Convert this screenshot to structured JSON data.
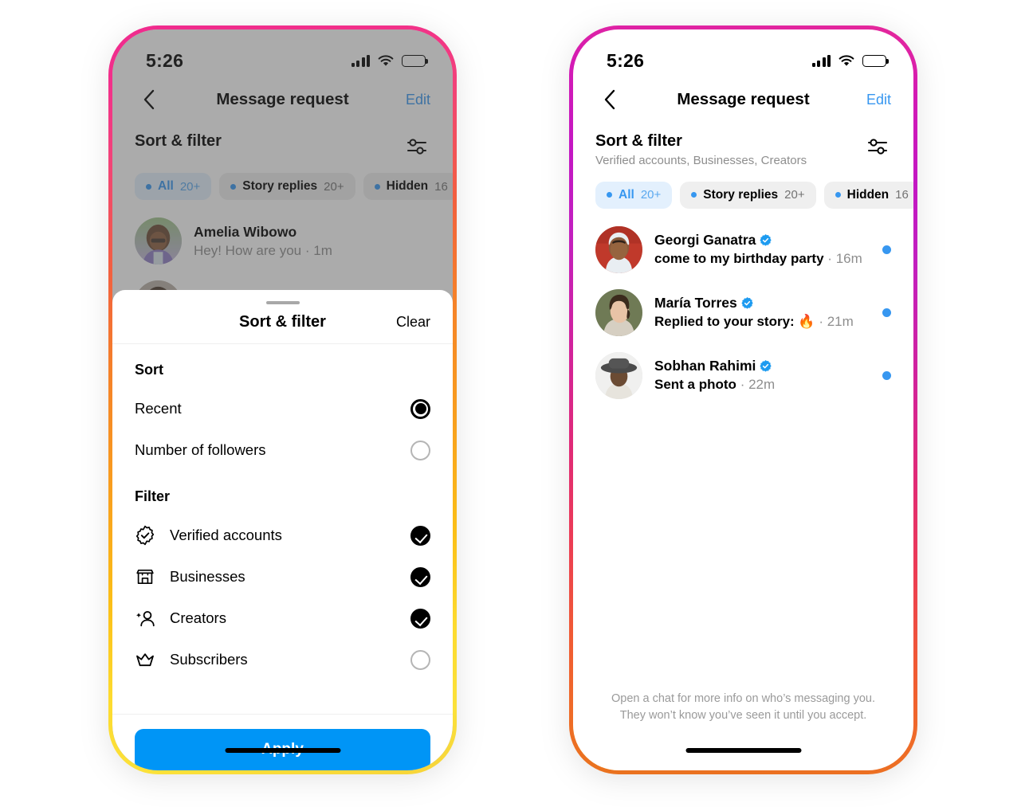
{
  "status_bar": {
    "time": "5:26",
    "signal_icon": "cellular-bars-icon",
    "wifi_icon": "wifi-icon",
    "battery_icon": "battery-full-icon"
  },
  "colors": {
    "accent_blue": "#3797f0",
    "button_blue": "#0095f6",
    "chip_active_bg": "#e3f0fd",
    "chip_bg": "#efefef",
    "muted_text": "#8e8e8e",
    "verified_blue": "#1d9bf0"
  },
  "nav": {
    "back_icon": "chevron-left-icon",
    "title": "Message request",
    "edit_label": "Edit"
  },
  "sort_filter_header": {
    "title": "Sort & filter",
    "subtitle_left": "",
    "subtitle_right": "Verified accounts, Businesses, Creators",
    "icon": "sliders-filter-icon"
  },
  "chips": [
    {
      "label": "All",
      "count": "20+",
      "active": true
    },
    {
      "label": "Story replies",
      "count": "20+",
      "active": false
    },
    {
      "label": "Hidden",
      "count": "16",
      "active": false
    }
  ],
  "left_phone": {
    "messages": [
      {
        "name": "Amelia Wibowo",
        "verified": false,
        "preview": "Hey! How are you",
        "time": "1m",
        "unread": false
      }
    ]
  },
  "right_phone": {
    "messages": [
      {
        "name": "Georgi Ganatra",
        "verified": true,
        "preview": "come to my birthday party",
        "time": "16m",
        "unread": true
      },
      {
        "name": "María Torres",
        "verified": true,
        "preview": "Replied to your story: 🔥",
        "time": "21m",
        "unread": true
      },
      {
        "name": "Sobhan Rahimi",
        "verified": true,
        "preview": "Sent a photo",
        "time": "22m",
        "unread": true
      }
    ],
    "footnote": "Open a chat for more info on who’s messaging you. They won’t know you’ve seen it until you accept."
  },
  "sheet": {
    "title": "Sort & filter",
    "clear_label": "Clear",
    "sort_label": "Sort",
    "sort_options": [
      {
        "label": "Recent",
        "selected": true
      },
      {
        "label": "Number of followers",
        "selected": false
      }
    ],
    "filter_label": "Filter",
    "filter_options": [
      {
        "label": "Verified accounts",
        "icon": "verified-badge-icon",
        "checked": true
      },
      {
        "label": "Businesses",
        "icon": "storefront-icon",
        "checked": true
      },
      {
        "label": "Creators",
        "icon": "creator-person-star-icon",
        "checked": true
      },
      {
        "label": "Subscribers",
        "icon": "crown-icon",
        "checked": false
      }
    ],
    "apply_label": "Apply"
  }
}
